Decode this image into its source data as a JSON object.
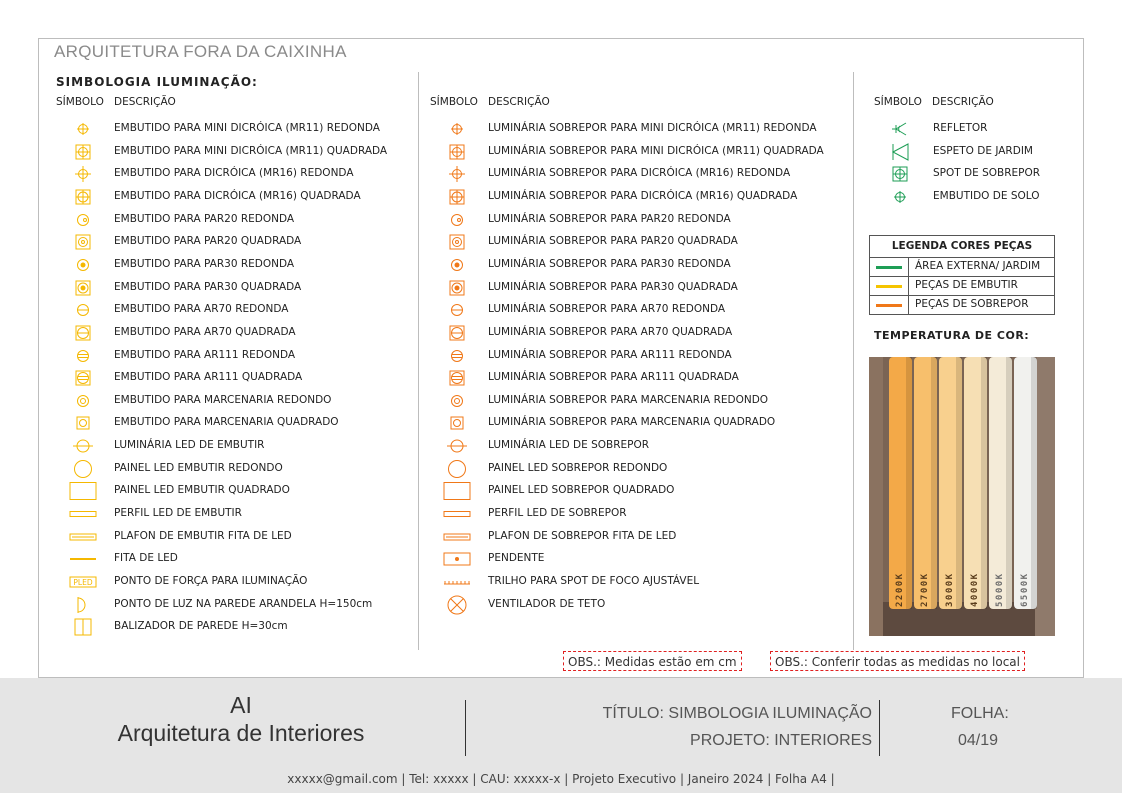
{
  "office_name": "ARQUITETURA FORA DA CAIXINHA",
  "sheet_title": "SIMBOLOGIA ILUMINAÇÃO:",
  "headers": {
    "symbol": "SÍMBOLO",
    "description": "DESCRIÇÃO"
  },
  "colors": {
    "embutir": "#f5b800",
    "sobrepor": "#f07818",
    "jardim": "#1e9e56",
    "obs_border": "#e02020"
  },
  "col1": [
    {
      "icon": "circle-cross-small-icon",
      "label": "EMBUTIDO PARA MINI DICRÓICA (MR11) REDONDA"
    },
    {
      "icon": "square-circle-cross-icon",
      "label": "EMBUTIDO PARA MINI DICRÓICA (MR11) QUADRADA"
    },
    {
      "icon": "circle-cross-extended-icon",
      "label": "EMBUTIDO PARA DICRÓICA (MR16) REDONDA"
    },
    {
      "icon": "square-circle-cross-extended-icon",
      "label": "EMBUTIDO PARA DICRÓICA (MR16) QUADRADA"
    },
    {
      "icon": "circle-dot-icon",
      "label": "EMBUTIDO PARA PAR20 REDONDA"
    },
    {
      "icon": "square-circle-dot-icon",
      "label": "EMBUTIDO PARA PAR20 QUADRADA"
    },
    {
      "icon": "circle-filled-dot-icon",
      "label": "EMBUTIDO PARA PAR30 REDONDA"
    },
    {
      "icon": "square-circle-filled-dot-icon",
      "label": "EMBUTIDO PARA PAR30 QUADRADA"
    },
    {
      "icon": "circle-hline-icon",
      "label": "EMBUTIDO PARA AR70 REDONDA"
    },
    {
      "icon": "square-circle-hline-icon",
      "label": "EMBUTIDO PARA AR70 QUADRADA"
    },
    {
      "icon": "circle-double-hline-icon",
      "label": "EMBUTIDO PARA AR111 REDONDA"
    },
    {
      "icon": "square-circle-double-hline-icon",
      "label": "EMBUTIDO PARA AR111 QUADRADA"
    },
    {
      "icon": "concentric-circle-icon",
      "label": "EMBUTIDO PARA MARCENARIA REDONDO"
    },
    {
      "icon": "square-concentric-circle-icon",
      "label": "EMBUTIDO PARA MARCENARIA QUADRADO"
    },
    {
      "icon": "led-circle-line-icon",
      "label": "LUMINÁRIA LED DE EMBUTIR"
    },
    {
      "icon": "large-circle-icon",
      "label": "PAINEL LED EMBUTIR REDONDO"
    },
    {
      "icon": "large-square-icon",
      "label": "PAINEL LED EMBUTIR QUADRADO"
    },
    {
      "icon": "profile-bar-icon",
      "label": "PERFIL LED DE EMBUTIR"
    },
    {
      "icon": "plafon-bar-icon",
      "label": "PLAFON DE EMBUTIR FITA DE LED"
    },
    {
      "icon": "led-strip-icon",
      "label": "FITA DE LED"
    },
    {
      "icon": "power-point-led-icon",
      "label": "PONTO DE FORÇA PARA ILUMINAÇÃO"
    },
    {
      "icon": "wall-sconce-icon",
      "label": "PONTO DE LUZ NA PAREDE ARANDELA H=150cm"
    },
    {
      "icon": "wall-bollard-icon",
      "label": "BALIZADOR DE PAREDE H=30cm"
    }
  ],
  "col2": [
    {
      "icon": "circle-cross-small-icon",
      "label": "LUMINÁRIA SOBREPOR PARA MINI DICRÓICA (MR11) REDONDA"
    },
    {
      "icon": "square-circle-cross-icon",
      "label": "LUMINÁRIA SOBREPOR PARA MINI DICRÓICA (MR11) QUADRADA"
    },
    {
      "icon": "circle-cross-extended-icon",
      "label": "LUMINÁRIA SOBREPOR PARA DICRÓICA (MR16) REDONDA"
    },
    {
      "icon": "square-circle-cross-extended-icon",
      "label": "LUMINÁRIA SOBREPOR PARA DICRÓICA (MR16) QUADRADA"
    },
    {
      "icon": "circle-dot-icon",
      "label": "LUMINÁRIA SOBREPOR PARA PAR20 REDONDA"
    },
    {
      "icon": "square-circle-dot-icon",
      "label": "LUMINÁRIA SOBREPOR PARA PAR20 QUADRADA"
    },
    {
      "icon": "circle-filled-dot-icon",
      "label": "LUMINÁRIA SOBREPOR PARA PAR30 REDONDA"
    },
    {
      "icon": "square-circle-filled-dot-icon",
      "label": "LUMINÁRIA SOBREPOR PARA PAR30 QUADRADA"
    },
    {
      "icon": "circle-hline-icon",
      "label": "LUMINÁRIA SOBREPOR PARA AR70 REDONDA"
    },
    {
      "icon": "square-circle-hline-icon",
      "label": "LUMINÁRIA SOBREPOR PARA AR70 QUADRADA"
    },
    {
      "icon": "circle-double-hline-icon",
      "label": "LUMINÁRIA SOBREPOR PARA AR111 REDONDA"
    },
    {
      "icon": "square-circle-double-hline-icon",
      "label": "LUMINÁRIA SOBREPOR PARA AR111 QUADRADA"
    },
    {
      "icon": "concentric-circle-icon",
      "label": "LUMINÁRIA SOBREPOR PARA MARCENARIA REDONDO"
    },
    {
      "icon": "square-concentric-circle-icon",
      "label": "LUMINÁRIA SOBREPOR PARA MARCENARIA QUADRADO"
    },
    {
      "icon": "led-circle-line-icon",
      "label": "LUMINÁRIA LED DE SOBREPOR"
    },
    {
      "icon": "large-circle-icon",
      "label": "PAINEL LED SOBREPOR REDONDO"
    },
    {
      "icon": "large-square-icon",
      "label": "PAINEL LED SOBREPOR QUADRADO"
    },
    {
      "icon": "profile-bar-icon",
      "label": "PERFIL LED DE SOBREPOR"
    },
    {
      "icon": "plafon-bar-icon",
      "label": "PLAFON DE SOBREPOR FITA DE LED"
    },
    {
      "icon": "pendant-icon",
      "label": "PENDENTE"
    },
    {
      "icon": "track-rail-icon",
      "label": "TRILHO PARA SPOT DE FOCO AJUSTÁVEL"
    },
    {
      "icon": "ceiling-fan-icon",
      "label": "VENTILADOR DE TETO"
    }
  ],
  "col3": [
    {
      "icon": "floodlight-icon",
      "label": "REFLETOR"
    },
    {
      "icon": "garden-spike-icon",
      "label": "ESPETO DE JARDIM"
    },
    {
      "icon": "square-circle-cross-icon",
      "label": "SPOT DE SOBREPOR"
    },
    {
      "icon": "circle-cross-small-icon",
      "label": "EMBUTIDO DE SOLO"
    }
  ],
  "legend": {
    "title": "LEGENDA CORES PEÇAS",
    "items": [
      {
        "label": "ÁREA EXTERNA/ JARDIM",
        "color": "#1e9e56"
      },
      {
        "label": "PEÇAS DE EMBUTIR",
        "color": "#f5c400"
      },
      {
        "label": "PEÇAS DE SOBREPOR",
        "color": "#f07818"
      }
    ]
  },
  "temperature": {
    "title": "TEMPERATURA DE COR:",
    "bars": [
      {
        "label": "2200K",
        "color": "#f3a948"
      },
      {
        "label": "2700K",
        "color": "#f7bf6c"
      },
      {
        "label": "3000K",
        "color": "#f8d08e"
      },
      {
        "label": "4000K",
        "color": "#f6dfb4"
      },
      {
        "label": "5000K",
        "color": "#f4ebd8"
      },
      {
        "label": "6500K",
        "color": "#f1f1ee"
      }
    ]
  },
  "obs": [
    "OBS.: Medidas estão em cm",
    "OBS.: Conferir todas as medidas no local"
  ],
  "footer": {
    "brand_line1": "AI",
    "brand_line2": "Arquitetura de Interiores",
    "title": "TÍTULO: SIMBOLOGIA ILUMINAÇÃO",
    "project": "PROJETO: INTERIORES",
    "sheet_label": "FOLHA:",
    "sheet_number": "04/19",
    "contact": "xxxxx@gmail.com  |  Tel: xxxxx | CAU: xxxxx-x | Projeto Executivo | Janeiro 2024 | Folha A4 |"
  }
}
